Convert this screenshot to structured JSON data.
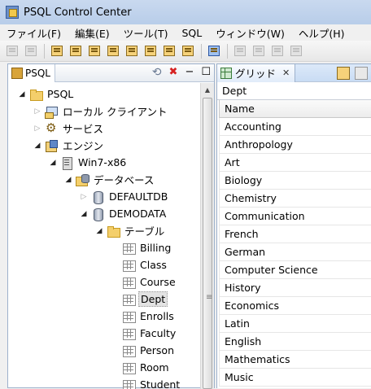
{
  "window": {
    "title": "PSQL Control Center"
  },
  "menu": [
    "ファイル(F)",
    "編集(E)",
    "ツール(T)",
    "SQL",
    "ウィンドウ(W)",
    "ヘルプ(H)"
  ],
  "left_panel": {
    "tab_label": "PSQL",
    "tree": [
      {
        "label": "PSQL",
        "icon": "folder-icon",
        "expander": "open"
      },
      {
        "label": "ローカル クライアント",
        "icon": "client-icon",
        "expander": "closed"
      },
      {
        "label": "サービス",
        "icon": "gear-icon",
        "expander": "closed"
      },
      {
        "label": "エンジン",
        "icon": "engine-icon",
        "expander": "open"
      },
      {
        "label": "Win7-x86",
        "icon": "server-icon",
        "expander": "open"
      },
      {
        "label": "データベース",
        "icon": "database-folder-icon",
        "expander": "open"
      },
      {
        "label": "DEFAULTDB",
        "icon": "database-icon",
        "expander": "closed"
      },
      {
        "label": "DEMODATA",
        "icon": "database-icon",
        "expander": "open"
      },
      {
        "label": "テーブル",
        "icon": "folder-icon",
        "expander": "open"
      },
      {
        "label": "Billing",
        "icon": "table-icon",
        "expander": "none"
      },
      {
        "label": "Class",
        "icon": "table-icon",
        "expander": "none"
      },
      {
        "label": "Course",
        "icon": "table-icon",
        "expander": "none"
      },
      {
        "label": "Dept",
        "icon": "table-icon",
        "expander": "none",
        "selected": true
      },
      {
        "label": "Enrolls",
        "icon": "table-icon",
        "expander": "none"
      },
      {
        "label": "Faculty",
        "icon": "table-icon",
        "expander": "none"
      },
      {
        "label": "Person",
        "icon": "table-icon",
        "expander": "none"
      },
      {
        "label": "Room",
        "icon": "table-icon",
        "expander": "none"
      },
      {
        "label": "Student",
        "icon": "table-icon",
        "expander": "none"
      }
    ]
  },
  "right_panel": {
    "tab_label": "グリッド",
    "grid_title": "Dept",
    "column": "Name",
    "rows": [
      "Accounting",
      "Anthropology",
      "Art",
      "Biology",
      "Chemistry",
      "Communication",
      "French",
      "German",
      "Computer Science",
      "History",
      "Economics",
      "Latin",
      "English",
      "Mathematics",
      "Music"
    ]
  },
  "toolbar": {
    "buttons": [
      "save-icon",
      "print-icon",
      "new-table-icon",
      "new-view-icon",
      "import-icon",
      "export-icon",
      "open-table-icon",
      "properties-icon",
      "user-icon",
      "group-icon",
      "refresh-icon",
      "execute-icon",
      "cut-icon",
      "copy-icon",
      "paste-icon"
    ]
  }
}
